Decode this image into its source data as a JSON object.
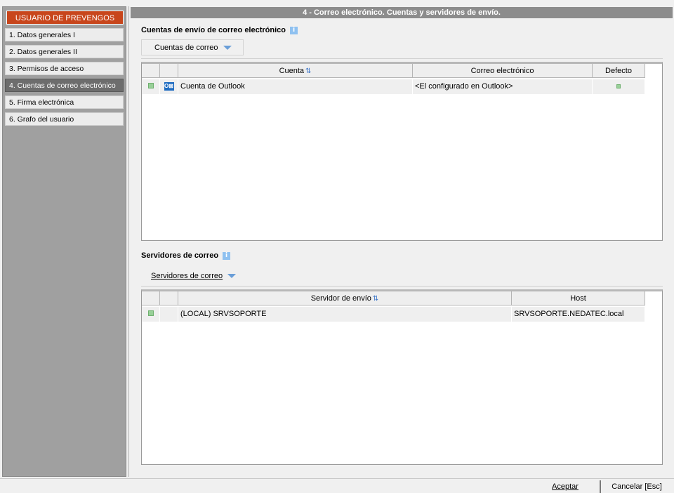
{
  "sidebar": {
    "header": "USUARIO DE PREVENGOS",
    "items": [
      {
        "label": "1. Datos generales I"
      },
      {
        "label": "2. Datos generales II"
      },
      {
        "label": "3. Permisos de acceso"
      },
      {
        "label": "4. Cuentas de correo electrónico"
      },
      {
        "label": "5. Firma electrónica"
      },
      {
        "label": "6. Grafo del usuario"
      }
    ]
  },
  "main": {
    "title": "4 - Correo electrónico. Cuentas y servidores de envío.",
    "accounts_section": {
      "title": "Cuentas de envío de correo electrónico",
      "menu_button": "Cuentas de correo",
      "columns": {
        "cuenta": "Cuenta",
        "correo": "Correo electrónico",
        "defecto": "Defecto"
      },
      "rows": [
        {
          "cuenta": "Cuenta de Outlook",
          "correo": "<El configurado en Outlook>",
          "icon": "outlook-icon"
        }
      ]
    },
    "servers_section": {
      "title": "Servidores de correo",
      "menu_button": "Servidores de correo",
      "columns": {
        "servidor": "Servidor de envío",
        "host": "Host"
      },
      "rows": [
        {
          "servidor": "(LOCAL) SRVSOPORTE",
          "host": "SRVSOPORTE.NEDATEC.local"
        }
      ]
    }
  },
  "footer": {
    "accept": "Aceptar",
    "cancel": "Cancelar [Esc]"
  },
  "colors": {
    "sidebar_header": "#c8461c",
    "active_nav": "#6d6d6d",
    "title_bar": "#8c8c8c",
    "status_green": "#98d098"
  }
}
